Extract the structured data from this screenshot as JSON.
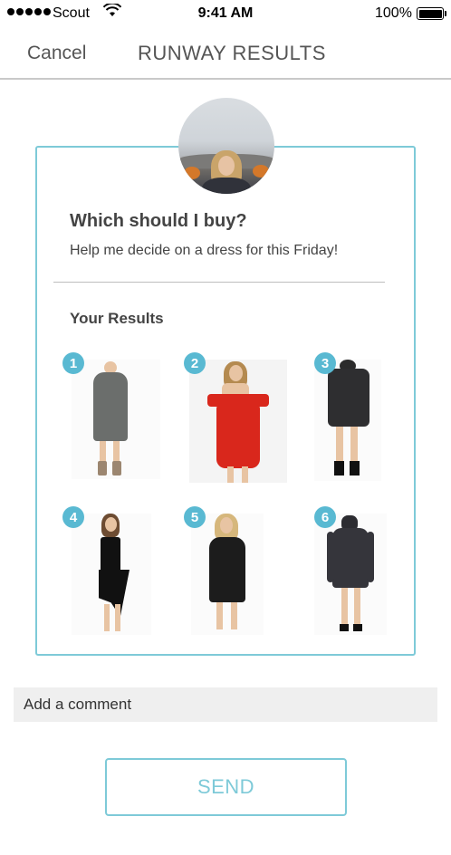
{
  "status_bar": {
    "carrier": "Scout",
    "time": "9:41 AM",
    "battery": "100%"
  },
  "nav": {
    "cancel_label": "Cancel",
    "title": "RUNWAY RESULTS"
  },
  "poll": {
    "question": "Which should I buy?",
    "description": "Help me decide on a dress for this Friday!",
    "results_heading": "Your Results",
    "results": [
      {
        "rank": "1",
        "dress": "grey turtleneck sweater dress"
      },
      {
        "rank": "2",
        "dress": "red off-shoulder dress"
      },
      {
        "rank": "3",
        "dress": "black shirt dress"
      },
      {
        "rank": "4",
        "dress": "black asymmetric slip dress"
      },
      {
        "rank": "5",
        "dress": "black turtleneck sweater dress"
      },
      {
        "rank": "6",
        "dress": "charcoal turtleneck sweater dress"
      }
    ]
  },
  "comment": {
    "placeholder": "Add a comment"
  },
  "send_label": "SEND",
  "colors": {
    "accent": "#59b9d2",
    "border": "#7ecad8"
  }
}
